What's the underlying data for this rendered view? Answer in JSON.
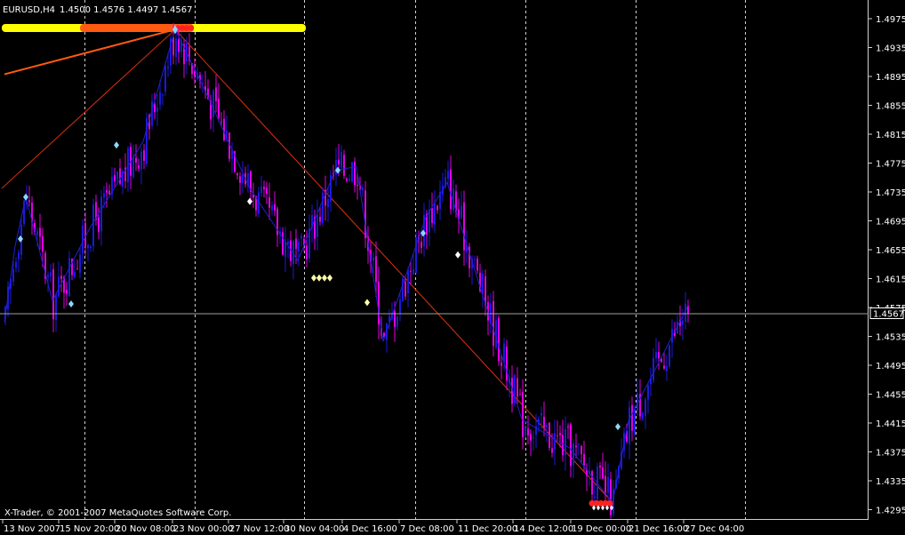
{
  "header": {
    "symbol_timeframe": "EURUSD,H4",
    "ohlc": "1.4500 1.4576 1.4497 1.4567"
  },
  "copyright": "X-Trader, © 2001-2007 MetaQuotes Software Corp.",
  "current_price_label": "1.4567",
  "colors": {
    "background": "#000000",
    "candle_up": "#1a1adc",
    "candle_down": "#e000e0",
    "zigzag": "#2020d0",
    "trendline": "#e03010",
    "yellow_band": "#ffff00",
    "orange_band": "#ff5a10",
    "marker_light_blue": "#8ad8ff",
    "marker_white": "#ffffff",
    "marker_cream": "#ffffaa",
    "marker_red": "#ff2020",
    "grid_separator": "#d0d0d0",
    "axis_text": "#ffffff"
  },
  "chart_data": {
    "type": "candlestick",
    "symbol": "EURUSD",
    "timeframe": "H4",
    "ylim": [
      1.4275,
      1.4995
    ],
    "y_ticks": [
      "1.4975",
      "1.4935",
      "1.4895",
      "1.4855",
      "1.4815",
      "1.4775",
      "1.4735",
      "1.4695",
      "1.4655",
      "1.4615",
      "1.4575",
      "1.4535",
      "1.4495",
      "1.4455",
      "1.4415",
      "1.4375",
      "1.4335",
      "1.4295"
    ],
    "x_ticks": [
      "13 Nov 2007",
      "15 Nov 20:00",
      "20 Nov 08:00",
      "23 Nov 00:00",
      "27 Nov 12:00",
      "30 Nov 04:00",
      "4 Dec 16:00",
      "7 Dec 08:00",
      "11 Dec 20:00",
      "14 Dec 12:00",
      "19 Dec 00:00",
      "21 Dec 16:00",
      "27 Dec 04:00"
    ],
    "grid": "vertical dashed separators",
    "current_price": 1.4567,
    "zigzag": [
      {
        "bar": 0,
        "price": 1.4555
      },
      {
        "bar": 4,
        "price": 1.466
      },
      {
        "bar": 8,
        "price": 1.4728
      },
      {
        "bar": 18,
        "price": 1.4584
      },
      {
        "bar": 32,
        "price": 1.4685
      },
      {
        "bar": 52,
        "price": 1.4805
      },
      {
        "bar": 64,
        "price": 1.496
      },
      {
        "bar": 74,
        "price": 1.4885
      },
      {
        "bar": 92,
        "price": 1.474
      },
      {
        "bar": 110,
        "price": 1.464
      },
      {
        "bar": 124,
        "price": 1.4765
      },
      {
        "bar": 132,
        "price": 1.477
      },
      {
        "bar": 142,
        "price": 1.4528
      },
      {
        "bar": 158,
        "price": 1.47
      },
      {
        "bar": 166,
        "price": 1.4748
      },
      {
        "bar": 194,
        "price": 1.442
      },
      {
        "bar": 212,
        "price": 1.438
      },
      {
        "bar": 228,
        "price": 1.4305
      },
      {
        "bar": 234,
        "price": 1.4418
      },
      {
        "bar": 256,
        "price": 1.4575
      }
    ],
    "trendlines": [
      {
        "from": {
          "bar": -1,
          "price": 1.474
        },
        "to": {
          "bar": 64,
          "price": 1.496
        }
      },
      {
        "from": {
          "bar": 0,
          "price": 1.4898
        },
        "to": {
          "bar": 64,
          "price": 1.496
        }
      },
      {
        "from": {
          "bar": 64,
          "price": 1.496
        },
        "to": {
          "bar": 228,
          "price": 1.4305
        }
      }
    ],
    "markers": [
      {
        "bar": 6,
        "price": 1.467,
        "color": "light_blue"
      },
      {
        "bar": 8,
        "price": 1.4728,
        "color": "light_blue"
      },
      {
        "bar": 25,
        "price": 1.458,
        "color": "light_blue"
      },
      {
        "bar": 42,
        "price": 1.48,
        "color": "light_blue"
      },
      {
        "bar": 125,
        "price": 1.4765,
        "color": "light_blue"
      },
      {
        "bar": 157,
        "price": 1.4678,
        "color": "light_blue"
      },
      {
        "bar": 230,
        "price": 1.441,
        "color": "light_blue"
      },
      {
        "bar": 92,
        "price": 1.4722,
        "color": "white"
      },
      {
        "bar": 170,
        "price": 1.4648,
        "color": "white"
      },
      {
        "bar": 136,
        "price": 1.4582,
        "color": "cream"
      },
      {
        "bar": 116,
        "price": 1.4616,
        "color": "cream"
      },
      {
        "bar": 118,
        "price": 1.4616,
        "color": "cream"
      },
      {
        "bar": 120,
        "price": 1.4616,
        "color": "cream"
      },
      {
        "bar": 122,
        "price": 1.4616,
        "color": "cream"
      }
    ]
  }
}
